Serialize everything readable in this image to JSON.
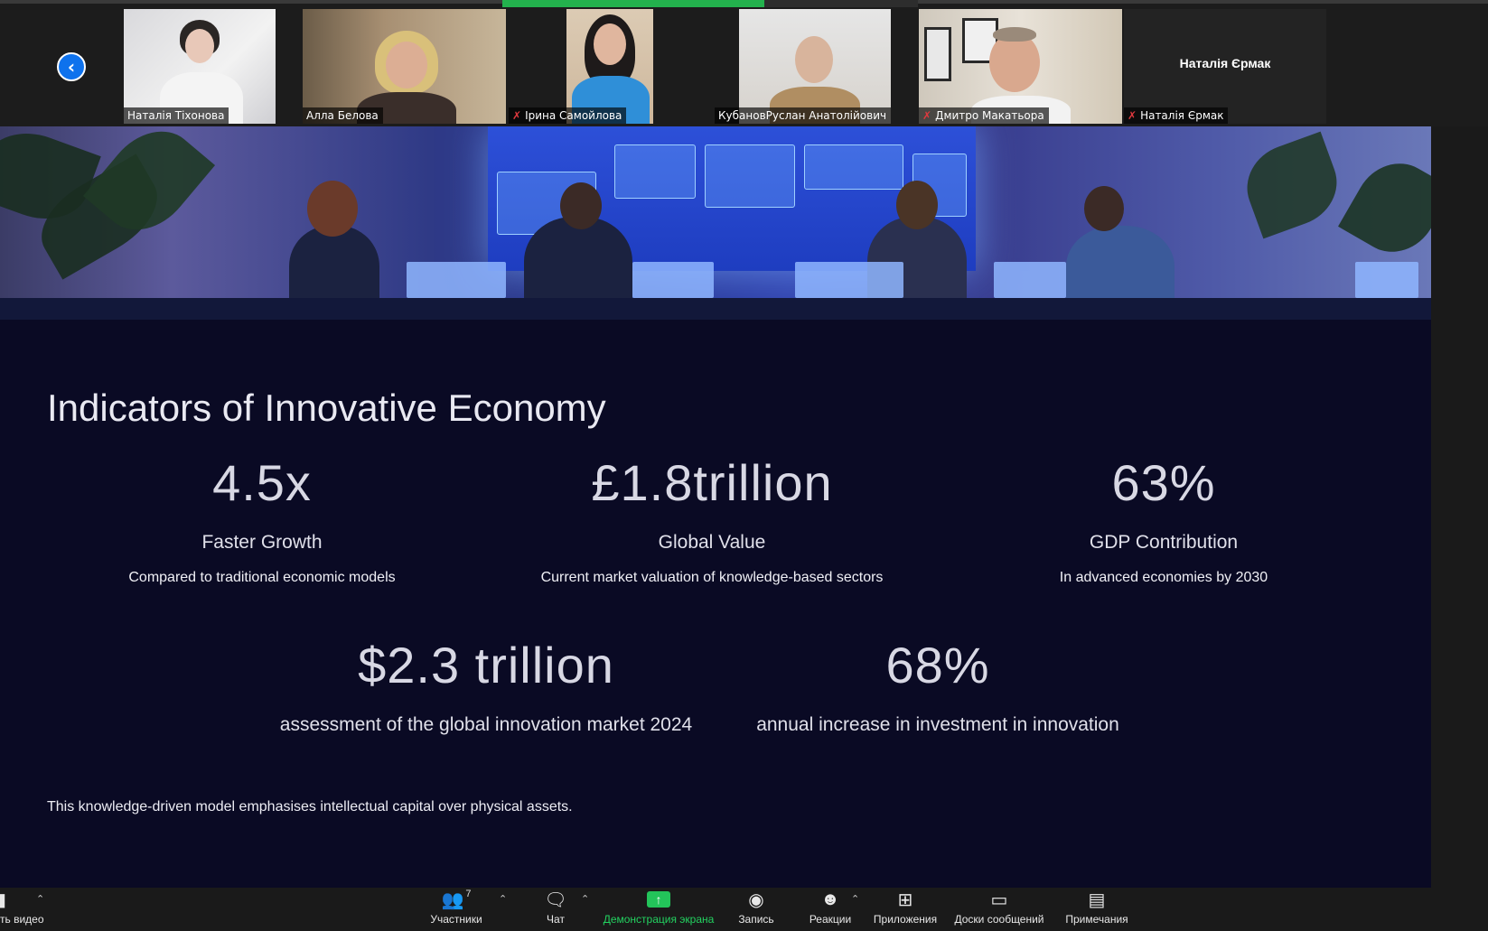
{
  "participants": {
    "tiles": [
      {
        "name": "Наталія Тіхонова",
        "muted": false
      },
      {
        "name": "Алла Белова",
        "muted": false
      },
      {
        "name": "Ірина Самойлова",
        "muted": true
      },
      {
        "name": "КубановРуслан Анатолійович",
        "muted": false
      },
      {
        "name": "Дмитро Макатьора",
        "muted": true
      },
      {
        "name": "Наталія Єрмак",
        "muted": true
      }
    ],
    "active_speaker_name": "Наталія Єрмак"
  },
  "slide": {
    "title": "Indicators of Innovative Economy",
    "metrics_row1": [
      {
        "value": "4.5x",
        "label": "Faster Growth",
        "desc": "Compared to traditional economic models"
      },
      {
        "value": "£1.8trillion",
        "label": "Global Value",
        "desc": "Current market valuation of knowledge-based sectors"
      },
      {
        "value": "63%",
        "label": "GDP Contribution",
        "desc": "In advanced economies by 2030"
      }
    ],
    "metrics_row2": [
      {
        "value": "$2.3 trillion",
        "label": "assessment of the global innovation market 2024"
      },
      {
        "value": "68%",
        "label": "annual increase in investment in innovation"
      }
    ],
    "footnote": "This knowledge-driven model emphasises intellectual capital over physical assets."
  },
  "toolbar": {
    "video_label": "ть видео",
    "participants_label": "Участники",
    "participants_count": "7",
    "chat_label": "Чат",
    "share_label": "Демонстрация экрана",
    "record_label": "Запись",
    "reactions_label": "Реакции",
    "apps_label": "Приложения",
    "whiteboards_label": "Доски сообщений",
    "notes_label": "Примечания"
  },
  "colors": {
    "accent_blue": "#0e72ed",
    "share_green": "#23c45a",
    "mute_red": "#e0393e",
    "slide_bg": "#0a0a24"
  }
}
